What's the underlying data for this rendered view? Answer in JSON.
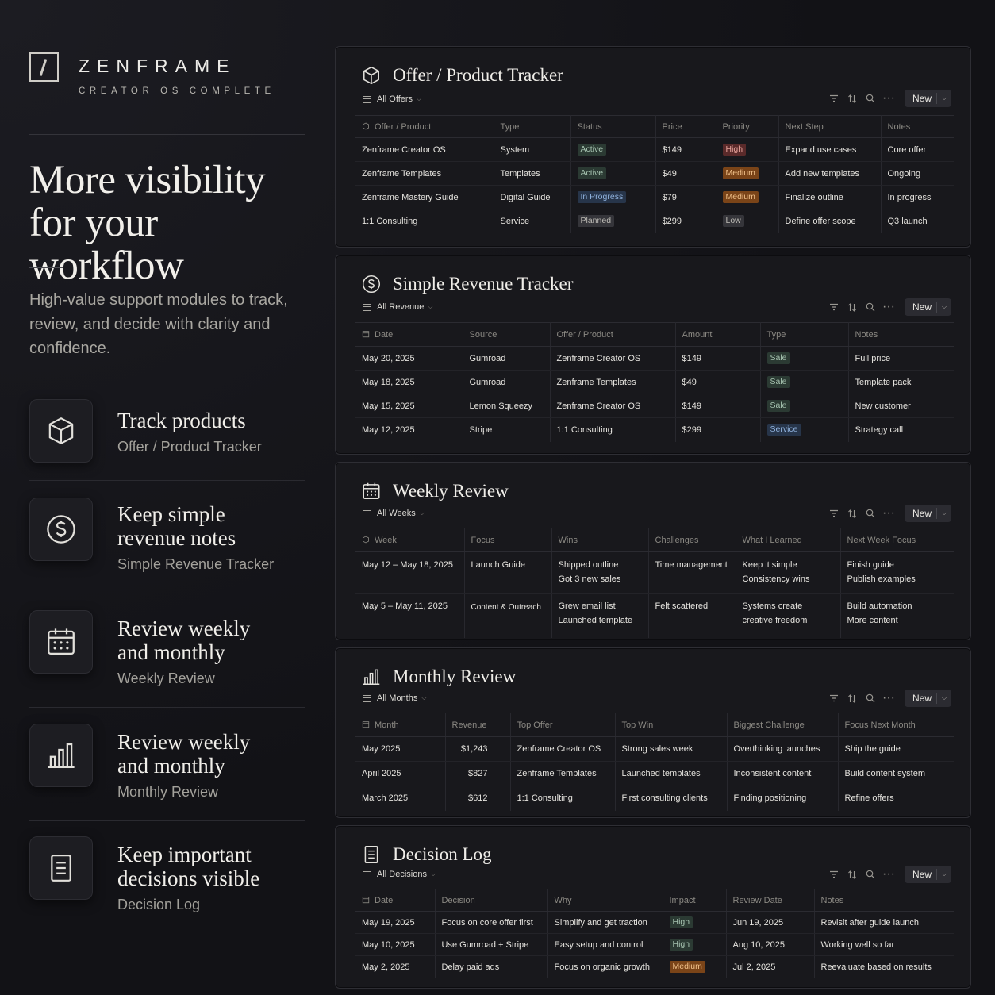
{
  "brand": {
    "name": "ZENFRAME",
    "subtitle": "CREATOR OS COMPLETE"
  },
  "hero": {
    "headline_line1": "More visibility",
    "headline_line2": "for your workflow",
    "lead": "High-value support modules to track, review, and decide with clarity and confidence."
  },
  "features": [
    {
      "icon": "cube-icon",
      "title_line1": "Track products",
      "title_line2": "",
      "subtitle": "Offer / Product Tracker"
    },
    {
      "icon": "dollar-icon",
      "title_line1": "Keep simple",
      "title_line2": "revenue notes",
      "subtitle": "Simple Revenue Tracker"
    },
    {
      "icon": "calendar-icon",
      "title_line1": "Review weekly",
      "title_line2": "and monthly",
      "subtitle": "Weekly Review"
    },
    {
      "icon": "bar-chart-icon",
      "title_line1": "Review weekly",
      "title_line2": "and monthly",
      "subtitle": "Monthly Review"
    },
    {
      "icon": "document-icon",
      "title_line1": "Keep important",
      "title_line2": "decisions visible",
      "subtitle": "Decision Log"
    }
  ],
  "toolbar": {
    "new_label": "New"
  },
  "offers": {
    "title": "Offer / Product Tracker",
    "view": "All Offers",
    "columns": [
      "Offer / Product",
      "Type",
      "Status",
      "Price",
      "Priority",
      "Next Step",
      "Notes"
    ],
    "rows": [
      {
        "name": "Zenframe Creator OS",
        "type": "System",
        "status": "Active",
        "price": "$149",
        "priority": "High",
        "next": "Expand use cases",
        "notes": "Core offer"
      },
      {
        "name": "Zenframe Templates",
        "type": "Templates",
        "status": "Active",
        "price": "$49",
        "priority": "Medium",
        "next": "Add new templates",
        "notes": "Ongoing"
      },
      {
        "name": "Zenframe Mastery Guide",
        "type": "Digital Guide",
        "status": "In Progress",
        "price": "$79",
        "priority": "Medium",
        "next": "Finalize outline",
        "notes": "In progress"
      },
      {
        "name": "1:1 Consulting",
        "type": "Service",
        "status": "Planned",
        "price": "$299",
        "priority": "Low",
        "next": "Define offer scope",
        "notes": "Q3 launch"
      }
    ]
  },
  "revenue": {
    "title": "Simple Revenue Tracker",
    "view": "All Revenue",
    "columns": [
      "Date",
      "Source",
      "Offer / Product",
      "Amount",
      "Type",
      "Notes"
    ],
    "rows": [
      {
        "date": "May 20, 2025",
        "source": "Gumroad",
        "offer": "Zenframe Creator OS",
        "amount": "$149",
        "type": "Sale",
        "notes": "Full price"
      },
      {
        "date": "May 18, 2025",
        "source": "Gumroad",
        "offer": "Zenframe Templates",
        "amount": "$49",
        "type": "Sale",
        "notes": "Template pack"
      },
      {
        "date": "May 15, 2025",
        "source": "Lemon Squeezy",
        "offer": "Zenframe Creator OS",
        "amount": "$149",
        "type": "Sale",
        "notes": "New customer"
      },
      {
        "date": "May 12, 2025",
        "source": "Stripe",
        "offer": "1:1 Consulting",
        "amount": "$299",
        "type": "Service",
        "notes": "Strategy call"
      }
    ]
  },
  "weekly": {
    "title": "Weekly Review",
    "view": "All Weeks",
    "columns": [
      "Week",
      "Focus",
      "Wins",
      "Challenges",
      "What I Learned",
      "Next Week Focus"
    ],
    "rows": [
      {
        "week": "May 12 – May 18, 2025",
        "focus": "Launch Guide",
        "wins1": "Shipped outline",
        "wins2": "Got 3 new sales",
        "challenges": "Time management",
        "learned1": "Keep it simple",
        "learned2": "Consistency wins",
        "next1": "Finish guide",
        "next2": "Publish examples"
      },
      {
        "week": "May 5 – May 11, 2025",
        "focus": "Content & Outreach",
        "wins1": "Grew email list",
        "wins2": "Launched template",
        "challenges": "Felt scattered",
        "learned1": "Systems create",
        "learned2": "creative freedom",
        "next1": "Build automation",
        "next2": "More content"
      }
    ]
  },
  "monthly": {
    "title": "Monthly Review",
    "view": "All Months",
    "columns": [
      "Month",
      "Revenue",
      "Top Offer",
      "Top Win",
      "Biggest Challenge",
      "Focus Next Month"
    ],
    "rows": [
      {
        "month": "May 2025",
        "revenue": "$1,243",
        "offer": "Zenframe Creator OS",
        "win": "Strong sales week",
        "challenge": "Overthinking launches",
        "focus": "Ship the guide"
      },
      {
        "month": "April 2025",
        "revenue": "$827",
        "offer": "Zenframe Templates",
        "win": "Launched templates",
        "challenge": "Inconsistent content",
        "focus": "Build content system"
      },
      {
        "month": "March 2025",
        "revenue": "$612",
        "offer": "1:1 Consulting",
        "win": "First consulting clients",
        "challenge": "Finding positioning",
        "focus": "Refine offers"
      }
    ]
  },
  "decisions": {
    "title": "Decision Log",
    "view": "All Decisions",
    "columns": [
      "Date",
      "Decision",
      "Why",
      "Impact",
      "Review Date",
      "Notes"
    ],
    "rows": [
      {
        "date": "May 19, 2025",
        "decision": "Focus on core offer first",
        "why": "Simplify and get traction",
        "impact": "High",
        "review": "Jun 19, 2025",
        "notes": "Revisit after guide launch"
      },
      {
        "date": "May 10, 2025",
        "decision": "Use Gumroad + Stripe",
        "why": "Easy setup and control",
        "impact": "High",
        "review": "Aug 10, 2025",
        "notes": "Working well so far"
      },
      {
        "date": "May 2, 2025",
        "decision": "Delay paid ads",
        "why": "Focus on organic growth",
        "impact": "Medium",
        "review": "Jul 2, 2025",
        "notes": "Reevaluate based on results"
      }
    ]
  },
  "colors": {
    "background": "#121216",
    "panel": "#18181c",
    "accent_orange": "#7a4418",
    "accent_red": "#5a2a2a",
    "accent_green": "#2b3a33",
    "accent_blue": "#27354a"
  }
}
